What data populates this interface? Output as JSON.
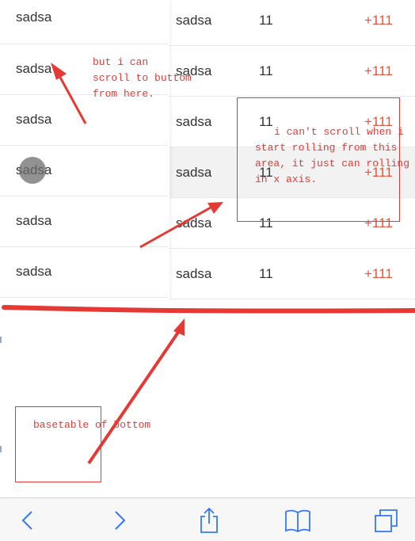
{
  "table": {
    "rows": [
      {
        "name": "sadsa",
        "name2": "sadsa",
        "qty": "11",
        "change": "+111"
      },
      {
        "name": "sadsa",
        "name2": "sadsa",
        "qty": "11",
        "change": "+111"
      },
      {
        "name": "sadsa",
        "name2": "sadsa",
        "qty": "11",
        "change": "+111"
      },
      {
        "name": "sadsa",
        "name2": "sadsa",
        "qty": "11",
        "change": "+111"
      },
      {
        "name": "sadsa",
        "name2": "sadsa",
        "qty": "11",
        "change": "+111"
      },
      {
        "name": "sadsa",
        "name2": "sadsa",
        "qty": "11",
        "change": "+111"
      }
    ]
  },
  "annotations": {
    "left_note": [
      "but i can",
      "scroll to buttom",
      "from here."
    ],
    "right_note": [
      "i can't scroll when i",
      "start rolling from this",
      "area, it just can rolling",
      "in x axis."
    ],
    "bottom_note": "basetable of bottom"
  },
  "colors": {
    "annotation": "#e53935",
    "change_value": "#e0553a",
    "toolbar_icon": "#3478f6"
  },
  "toolbar": {
    "icons": [
      "back-icon",
      "forward-icon",
      "share-icon",
      "bookmarks-icon",
      "tabs-icon"
    ]
  }
}
